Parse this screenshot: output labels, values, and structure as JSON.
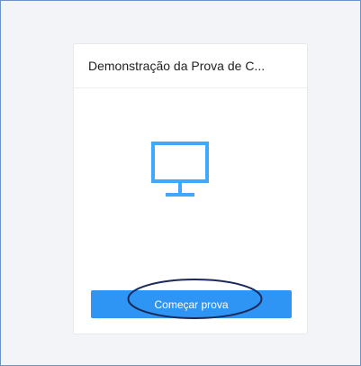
{
  "card": {
    "title": "Demonstração da Prova de C..."
  },
  "icon": {
    "name": "monitor-icon",
    "color": "#40a9ff"
  },
  "button": {
    "label": "Começar prova",
    "color": "#2f95f4"
  },
  "annotation": {
    "shape": "ellipse",
    "color": "#1b2a5a"
  }
}
